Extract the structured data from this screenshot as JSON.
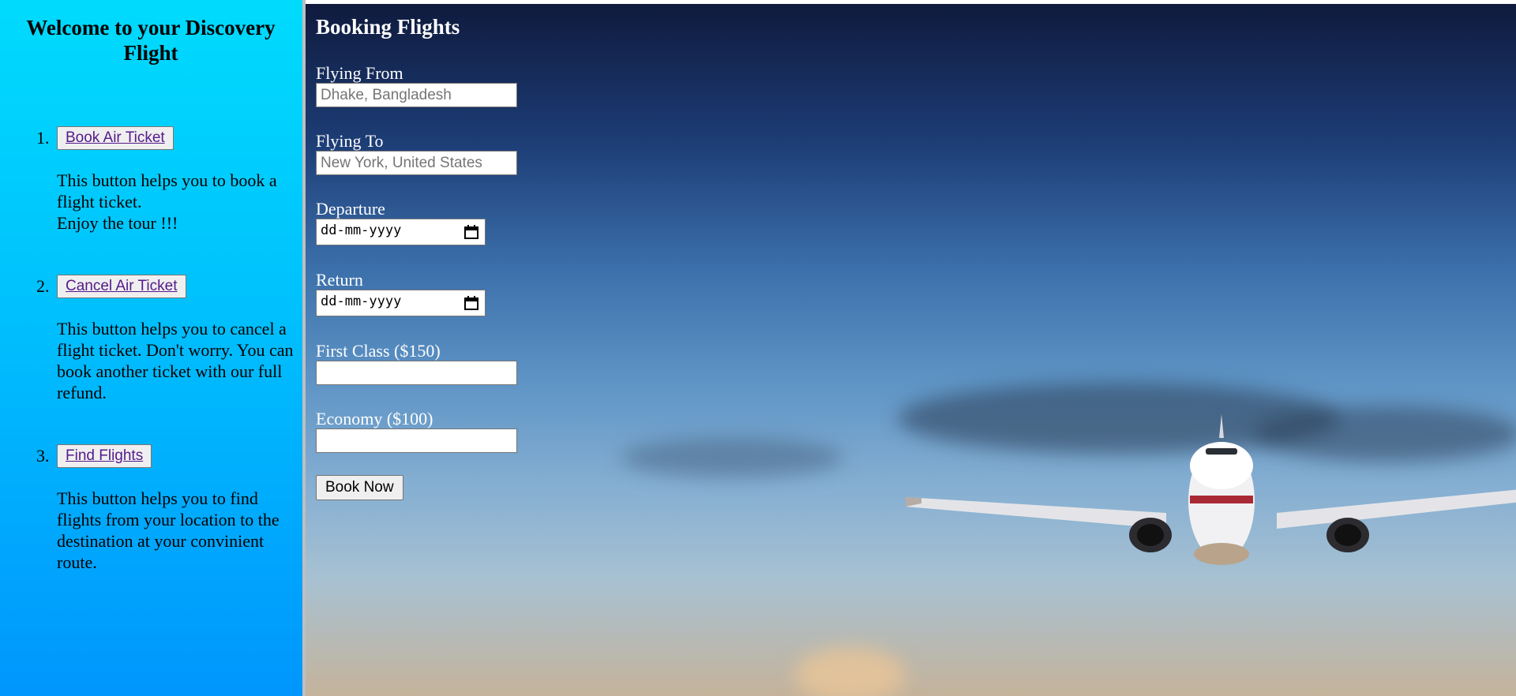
{
  "sidebar": {
    "title": "Welcome to your Discovery Flight",
    "items": [
      {
        "number": "1.",
        "button": "Book Air Ticket",
        "description": "This button helps you to book a flight ticket.\nEnjoy the tour !!!"
      },
      {
        "number": "2.",
        "button": "Cancel Air Ticket",
        "description": "This button helps you to cancel a flight ticket. Don't worry. You can book another ticket with our full refund."
      },
      {
        "number": "3.",
        "button": "Find Flights",
        "description": "This button helps you to find flights from your location to the destination at your convinient route."
      }
    ]
  },
  "form": {
    "title": "Booking Flights",
    "from_label": "Flying From",
    "from_placeholder": "Dhake, Bangladesh",
    "from_value": "",
    "to_label": "Flying To",
    "to_placeholder": "New York, United States",
    "to_value": "",
    "departure_label": "Departure",
    "departure_value": "dd-mm-yyyy",
    "return_label": "Return",
    "return_value": "dd-mm-yyyy",
    "first_class_label": "First Class ($150)",
    "first_class_value": "",
    "economy_label": "Economy ($100)",
    "economy_value": "",
    "submit_label": "Book Now"
  },
  "icons": {
    "calendar": "calendar-icon"
  },
  "colors": {
    "sidebar_top": "#00dbfd",
    "sidebar_bottom": "#0096fd",
    "link": "#551a8b",
    "form_text": "#ffffff"
  }
}
